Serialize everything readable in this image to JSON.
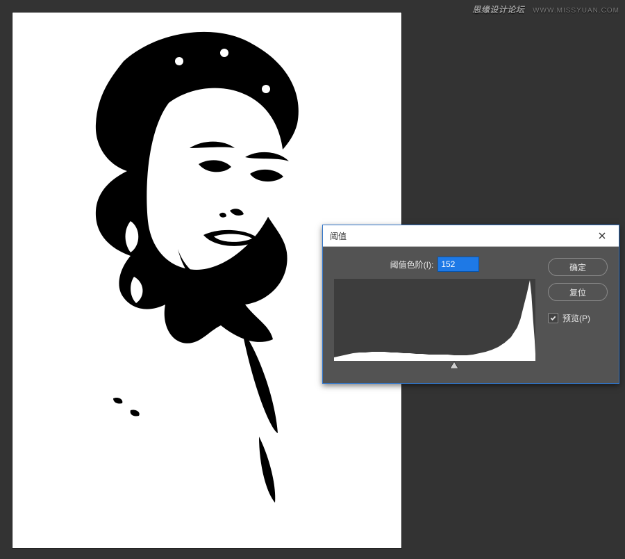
{
  "watermark": {
    "brand": "思缘设计论坛",
    "site": "WWW.MISSYUAN.COM"
  },
  "dialog": {
    "title": "阈值",
    "field_label": "阈值色阶(I):",
    "field_value": "152",
    "ok_label": "确定",
    "reset_label": "复位",
    "preview_label": "预览(P)",
    "preview_checked": true,
    "slider_pos_percent": 59.6
  },
  "chart_data": {
    "type": "area",
    "title": "",
    "xlabel": "",
    "ylabel": "",
    "x": [
      0,
      8,
      16,
      24,
      32,
      40,
      48,
      56,
      64,
      72,
      80,
      88,
      96,
      104,
      112,
      120,
      128,
      136,
      144,
      152,
      160,
      168,
      176,
      184,
      192,
      200,
      208,
      216,
      224,
      232,
      236,
      240,
      244,
      248,
      250,
      252,
      254,
      255
    ],
    "values": [
      5,
      7,
      9,
      11,
      12,
      12,
      13,
      13,
      13,
      12,
      12,
      11,
      11,
      10,
      10,
      9,
      9,
      9,
      9,
      8,
      8,
      8,
      9,
      11,
      13,
      16,
      20,
      26,
      34,
      48,
      60,
      78,
      96,
      116,
      95,
      60,
      30,
      10
    ],
    "xlim": [
      0,
      255
    ],
    "ylim": [
      0,
      118
    ],
    "current_threshold": 152
  }
}
